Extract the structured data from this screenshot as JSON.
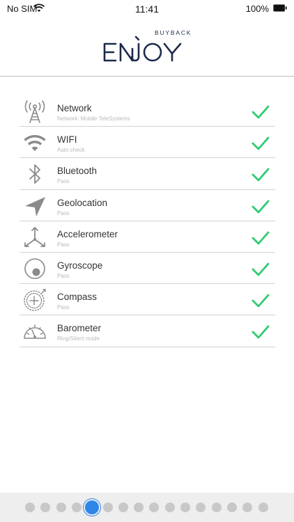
{
  "status_bar": {
    "carrier": "No SIM",
    "time": "11:41",
    "battery": "100%"
  },
  "brand": {
    "name": "ENJOY",
    "tagline": "BUYBACK",
    "color": "#1c2a4a"
  },
  "checks": [
    {
      "title": "Network",
      "subtitle": "Network: Mobile TeleSystems",
      "icon": "cell-tower-icon",
      "status": "pass"
    },
    {
      "title": "WIFI",
      "subtitle": "Auto check",
      "icon": "wifi-icon",
      "status": "pass"
    },
    {
      "title": "Bluetooth",
      "subtitle": "Pass",
      "icon": "bluetooth-icon",
      "status": "pass"
    },
    {
      "title": "Geolocation",
      "subtitle": "Pass",
      "icon": "location-arrow-icon",
      "status": "pass"
    },
    {
      "title": "Accelerometer",
      "subtitle": "Pass",
      "icon": "accelerometer-axes-icon",
      "status": "pass"
    },
    {
      "title": "Gyroscope",
      "subtitle": "Pass",
      "icon": "gyroscope-icon",
      "status": "pass"
    },
    {
      "title": "Compass",
      "subtitle": "Pass",
      "icon": "compass-icon",
      "status": "pass"
    },
    {
      "title": "Barometer",
      "subtitle": "Ring/Silent mode",
      "icon": "gauge-icon",
      "status": "pass"
    }
  ],
  "pager": {
    "total": 16,
    "active_index": 4
  },
  "colors": {
    "check": "#2ecc71",
    "accent": "#2f86e8",
    "icon": "#8a8a8a"
  }
}
